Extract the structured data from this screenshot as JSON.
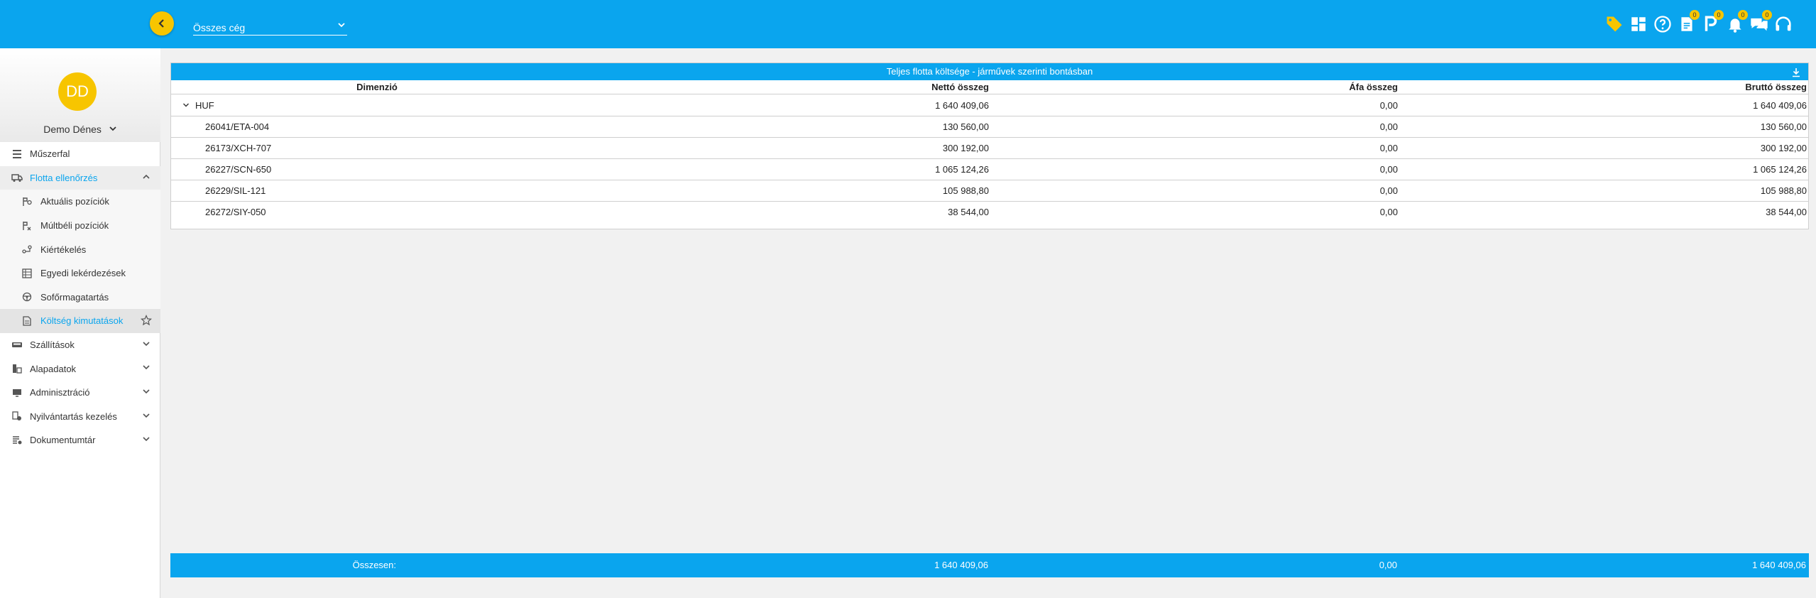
{
  "header": {
    "company_select_value": "Összes cég",
    "badges": {
      "documents": "0",
      "parking": "0",
      "notifications": "0",
      "messages": "0"
    }
  },
  "user": {
    "initials": "DD",
    "name": "Demo Dénes"
  },
  "menu": {
    "items": [
      {
        "label": "Műszerfal"
      },
      {
        "label": "Flotta ellenőrzés"
      },
      {
        "label": "Aktuális pozíciók"
      },
      {
        "label": "Múltbéli pozíciók"
      },
      {
        "label": "Kiértékelés"
      },
      {
        "label": "Egyedi lekérdezések"
      },
      {
        "label": "Sofőrmagatartás"
      },
      {
        "label": "Költség kimutatások"
      },
      {
        "label": "Szállítások"
      },
      {
        "label": "Alapadatok"
      },
      {
        "label": "Adminisztráció"
      },
      {
        "label": "Nyilvántartás kezelés"
      },
      {
        "label": "Dokumentumtár"
      }
    ]
  },
  "report": {
    "title": "Teljes flotta költsége - járművek szerinti bontásban",
    "columns": {
      "dimension": "Dimenzió",
      "net": "Nettó összeg",
      "vat": "Áfa összeg",
      "gross": "Bruttó összeg"
    },
    "rows": [
      {
        "dimension": "HUF",
        "net": "1 640 409,06",
        "vat": "0,00",
        "gross": "1 640 409,06"
      },
      {
        "dimension": "26041/ETA-004",
        "net": "130 560,00",
        "vat": "0,00",
        "gross": "130 560,00"
      },
      {
        "dimension": "26173/XCH-707",
        "net": "300 192,00",
        "vat": "0,00",
        "gross": "300 192,00"
      },
      {
        "dimension": "26227/SCN-650",
        "net": "1 065 124,26",
        "vat": "0,00",
        "gross": "1 065 124,26"
      },
      {
        "dimension": "26229/SIL-121",
        "net": "105 988,80",
        "vat": "0,00",
        "gross": "105 988,80"
      },
      {
        "dimension": "26272/SIY-050",
        "net": "38 544,00",
        "vat": "0,00",
        "gross": "38 544,00"
      }
    ],
    "total": {
      "label": "Összesen:",
      "net": "1 640 409,06",
      "vat": "0,00",
      "gross": "1 640 409,06"
    }
  },
  "colors": {
    "primary": "#0aa5ee",
    "accent": "#f7c500"
  }
}
